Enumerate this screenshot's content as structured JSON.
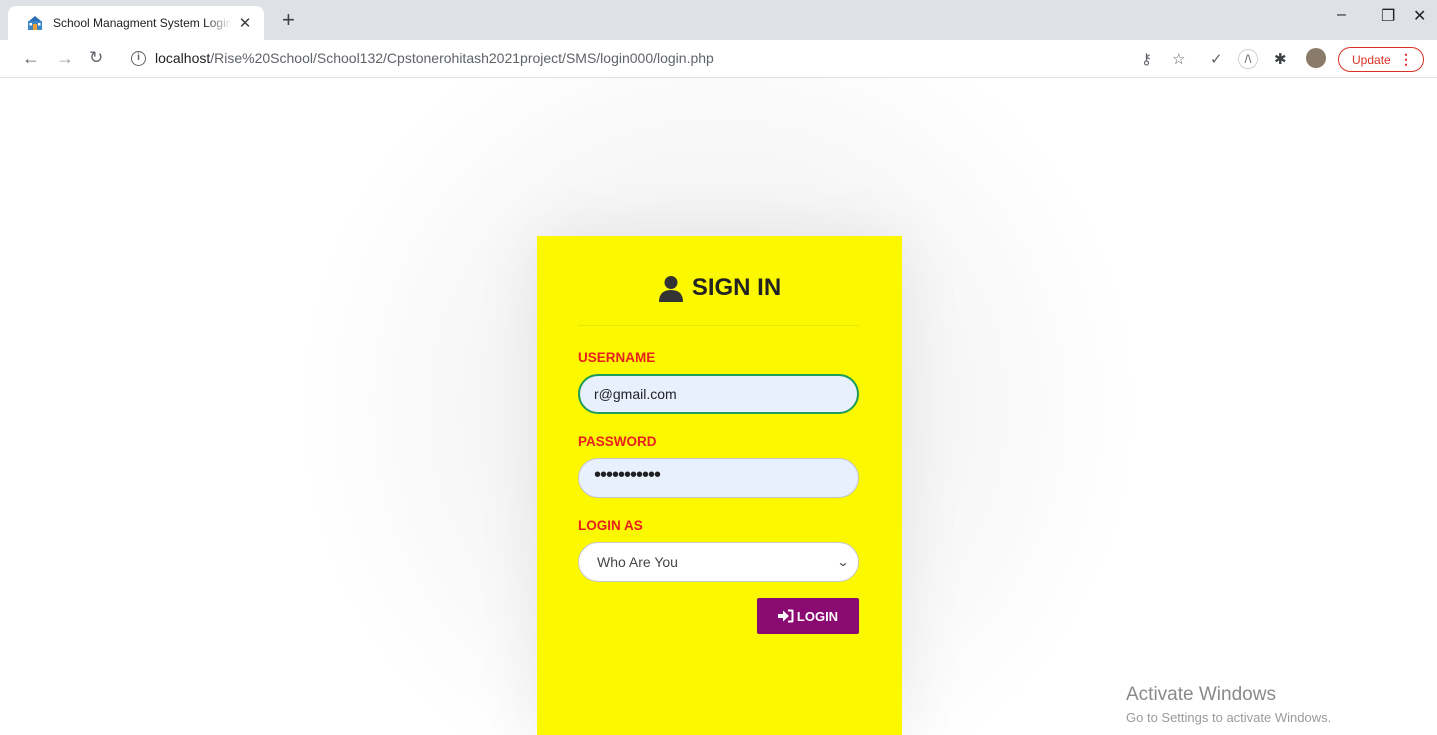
{
  "browser": {
    "tab_title": "School Managment System Login",
    "url_host": "localhost",
    "url_path": "/Rise%20School/School132/Cpstonerohitash2021project/SMS/login000/login.php",
    "update_label": "Update"
  },
  "login_form": {
    "title": "SIGN IN",
    "username_label": "USERNAME",
    "username_value": "r@gmail.com",
    "password_label": "PASSWORD",
    "password_value": "•••••••••••",
    "login_as_label": "LOGIN AS",
    "login_as_selected": "Who Are You",
    "login_button": "LOGIN"
  },
  "watermark": {
    "title": "Activate Windows",
    "subtitle": "Go to Settings to activate Windows."
  },
  "colors": {
    "card_background": "#fcf800",
    "label_red": "#e8201e",
    "button_purple": "#8b0a72"
  },
  "icons": {
    "tab_favicon": "school-building-icon",
    "title_icon": "user-icon",
    "button_icon": "sign-in-icon"
  }
}
